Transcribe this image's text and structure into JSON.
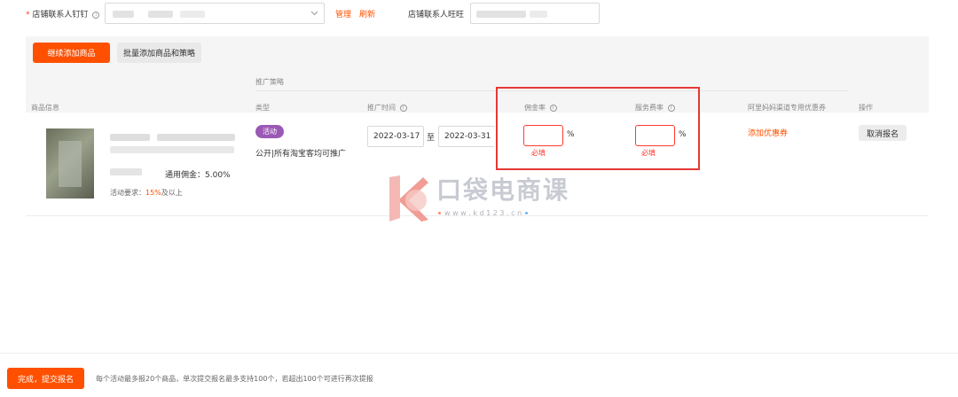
{
  "form": {
    "dingding_label": "店铺联系人钉钉",
    "manage_link": "管理",
    "refresh_link": "刷新",
    "wangwang_label": "店铺联系人旺旺"
  },
  "toolbar": {
    "add_product_label": "继续添加商品",
    "batch_add_label": "批量添加商品和策略"
  },
  "table": {
    "group_header": "推广策略",
    "columns": {
      "product_info": "商品信息",
      "type": "类型",
      "promo_time": "推广时间",
      "commission_rate": "佣金率",
      "service_rate": "服务费率",
      "coupon": "阿里妈妈渠道专用优惠券",
      "action": "操作"
    },
    "row": {
      "general_commission": "通用佣金：5.00%",
      "requirement_prefix": "活动要求：",
      "requirement_value": "15%",
      "requirement_suffix": "及以上",
      "type_tag": "活动",
      "type_desc": "公开|所有淘宝客均可推广",
      "start_date": "2022-03-17",
      "date_sep": "至",
      "end_date": "2022-03-31",
      "percent_sign": "%",
      "required_tip": "必填",
      "add_coupon": "添加优惠券",
      "cancel_button": "取消报名"
    }
  },
  "watermark": {
    "title": "口袋电商课",
    "url": "w w w . k d 1 2 3 . c n"
  },
  "footer": {
    "submit_label": "完成，提交报名",
    "note": "每个活动最多报20个商品，单次提交报名最多支持100个，若超出100个可进行再次提报"
  },
  "colors": {
    "accent": "#ff5000",
    "error": "#ff3b30",
    "tag": "#9b59b6"
  }
}
